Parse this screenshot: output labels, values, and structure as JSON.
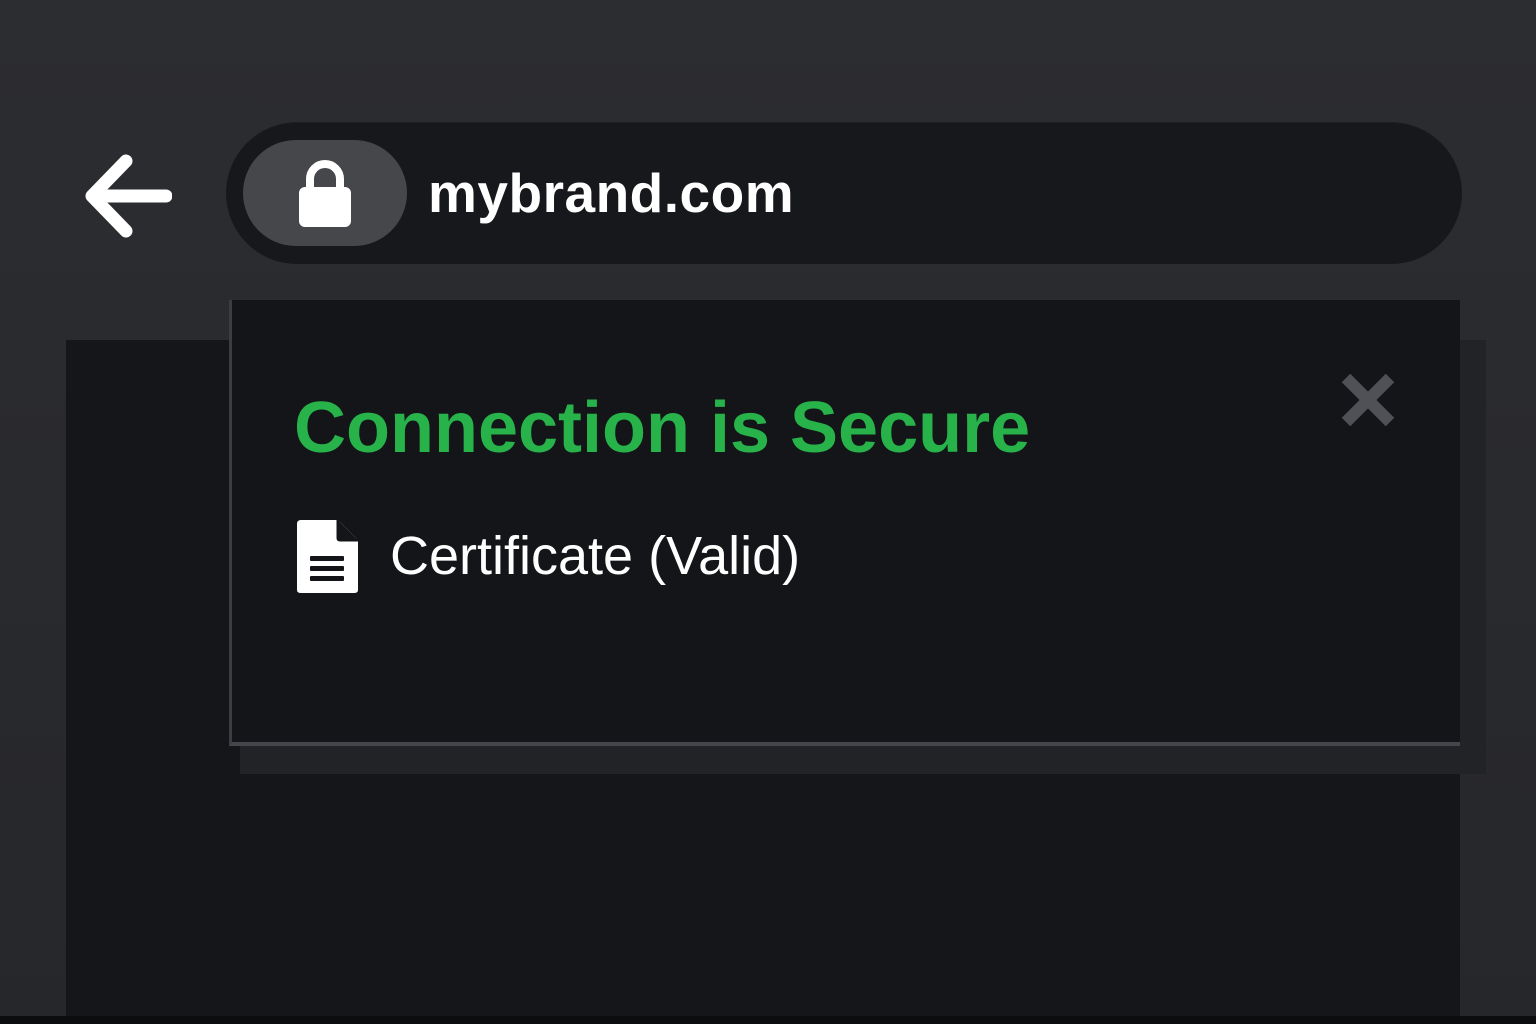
{
  "address_bar": {
    "url": "mybrand.com"
  },
  "icons": {
    "back": "arrow-left-icon",
    "lock": "lock-icon",
    "close": "close-icon",
    "certificate": "document-icon"
  },
  "security_popup": {
    "title": "Connection is Secure",
    "certificate_label": "Certificate (Valid)"
  },
  "colors": {
    "secure_green": "#27b24a",
    "background": "#2a2b2f",
    "panel": "#141518",
    "text": "#ffffff"
  }
}
